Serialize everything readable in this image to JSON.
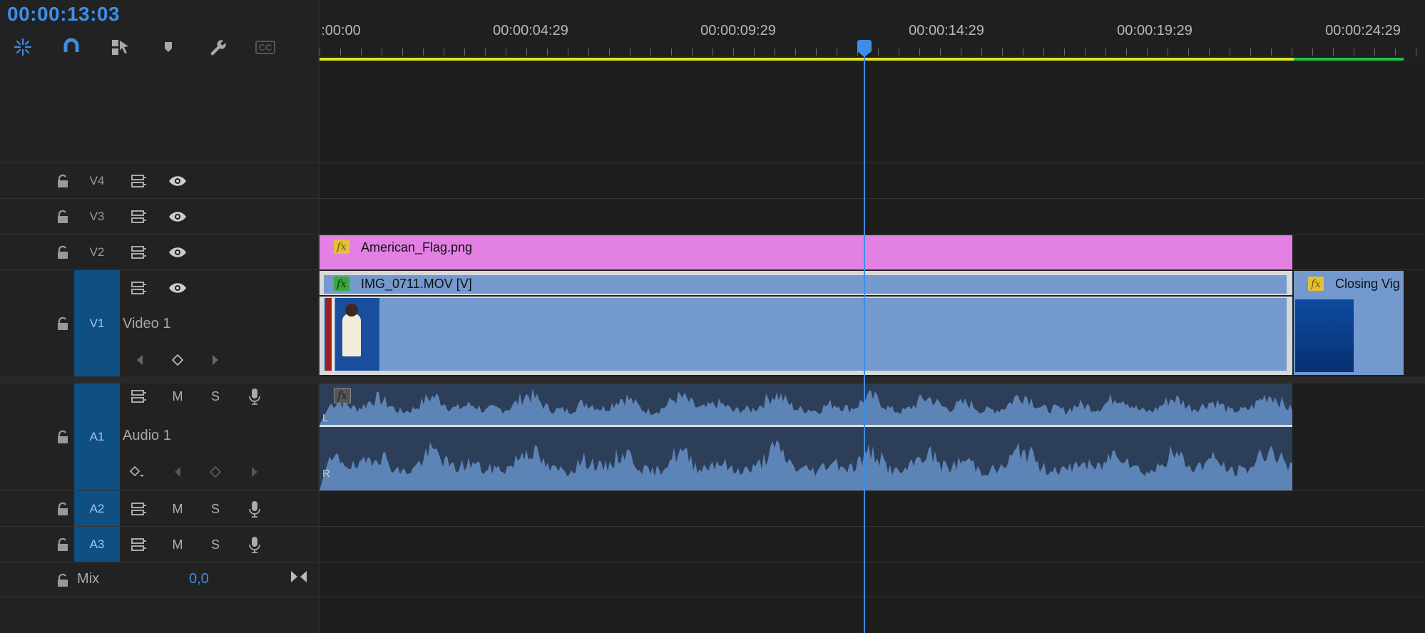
{
  "timecode": "00:00:13:03",
  "toolbar": {
    "tools": [
      "snap-insert-icon",
      "magnet-icon",
      "linked-selection-icon",
      "marker-icon",
      "wrench-icon",
      "captions-icon"
    ],
    "captions_label": "CC"
  },
  "ruler": {
    "labels": [
      ":00:00",
      "00:00:04:29",
      "00:00:09:29",
      "00:00:14:29",
      "00:00:19:29",
      "00:00:24:29"
    ]
  },
  "tracks": {
    "v4": {
      "id": "V4"
    },
    "v3": {
      "id": "V3"
    },
    "v2": {
      "id": "V2"
    },
    "v1": {
      "id": "V1",
      "name": "Video 1"
    },
    "a1": {
      "id": "A1",
      "name": "Audio 1",
      "m": "M",
      "s": "S",
      "ch_l": "L",
      "ch_r": "R"
    },
    "a2": {
      "id": "A2",
      "m": "M",
      "s": "S"
    },
    "a3": {
      "id": "A3",
      "m": "M",
      "s": "S"
    },
    "mix": {
      "label": "Mix",
      "value": "0,0"
    }
  },
  "clips": {
    "flag": {
      "name": "American_Flag.png",
      "fx": "fx",
      "color": "#e380e3"
    },
    "mov": {
      "name": "IMG_0711.MOV [V]",
      "fx": "fx",
      "color": "#7399cf"
    },
    "closing": {
      "name": "Closing Vig",
      "fx": "fx",
      "color": "#7399cf"
    },
    "audio": {
      "color": "#5d84b7"
    }
  },
  "colors": {
    "accent": "#3d8ee8",
    "work_area_rendered": "#e4e424",
    "work_area_green": "#20c040",
    "track_active": "#0f4f82"
  }
}
